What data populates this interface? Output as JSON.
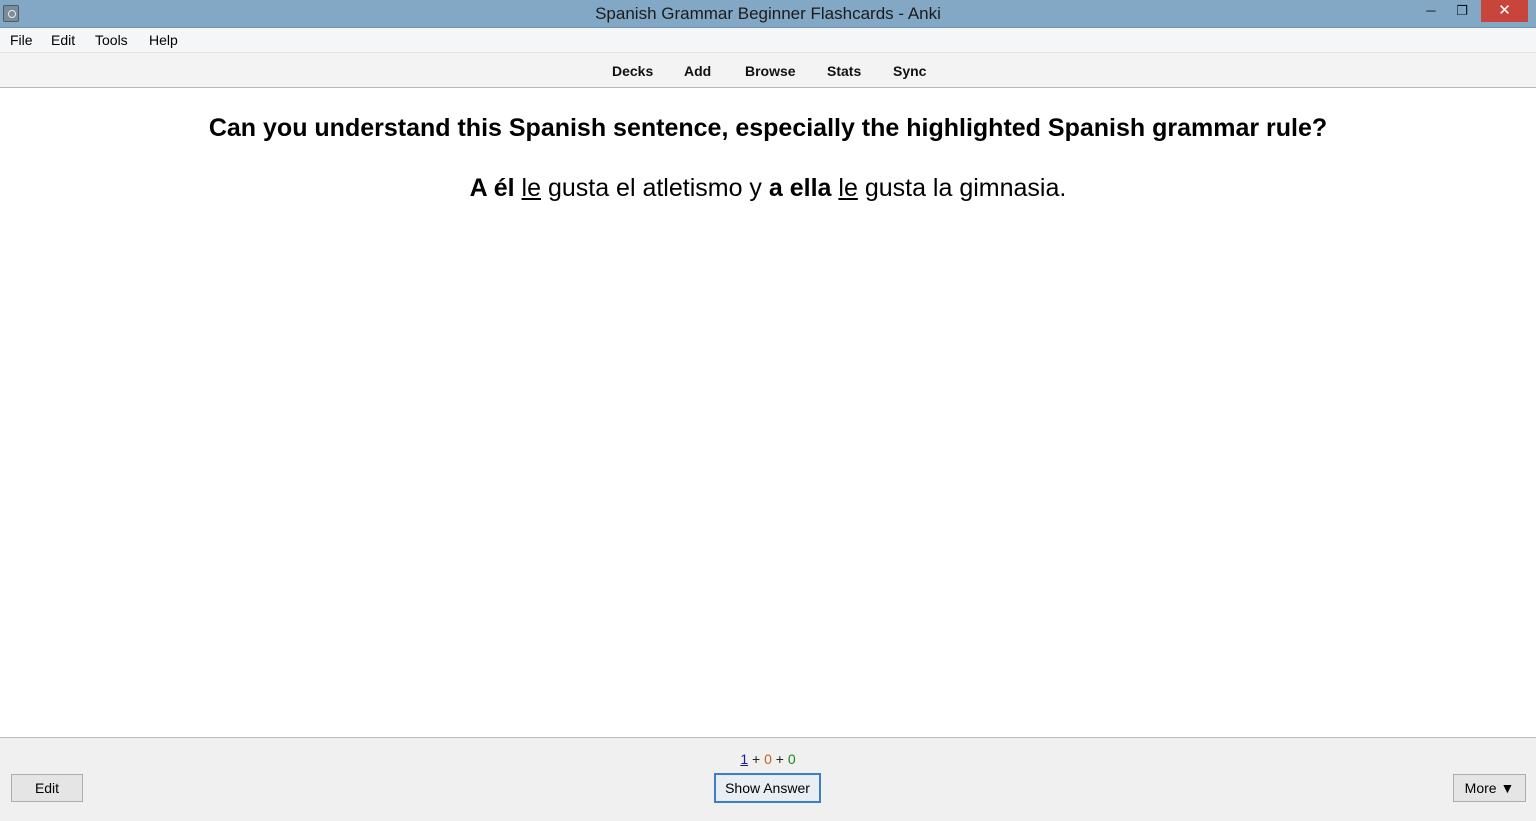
{
  "window": {
    "title": "Spanish Grammar Beginner Flashcards - Anki",
    "minimize_glyph": "─",
    "maximize_glyph": "❐",
    "close_glyph": "✕"
  },
  "menu": {
    "items": [
      "File",
      "Edit",
      "Tools",
      "Help"
    ]
  },
  "toolbar": {
    "links": [
      "Decks",
      "Add",
      "Browse",
      "Stats",
      "Sync"
    ]
  },
  "card": {
    "question": "Can you understand this Spanish sentence, especially the highlighted Spanish grammar rule?",
    "sentence": {
      "part1_bold": "A él",
      "part2_underline": "le",
      "part3": "gusta el atletismo y",
      "part4_bold": "a ella",
      "part5_underline": "le",
      "part6": "gusta la gimnasia."
    }
  },
  "counts": {
    "new": "1",
    "learning": "0",
    "review": "0",
    "separator": "+"
  },
  "buttons": {
    "edit": "Edit",
    "show_answer": "Show Answer",
    "more": "More ▼"
  },
  "colors": {
    "titlebar": "#82a8c6",
    "close_button": "#c7453a",
    "new_count": "#1a1aa0",
    "learning_count": "#c3621f",
    "review_count": "#178a17",
    "focus_border": "#3d7fc6"
  }
}
